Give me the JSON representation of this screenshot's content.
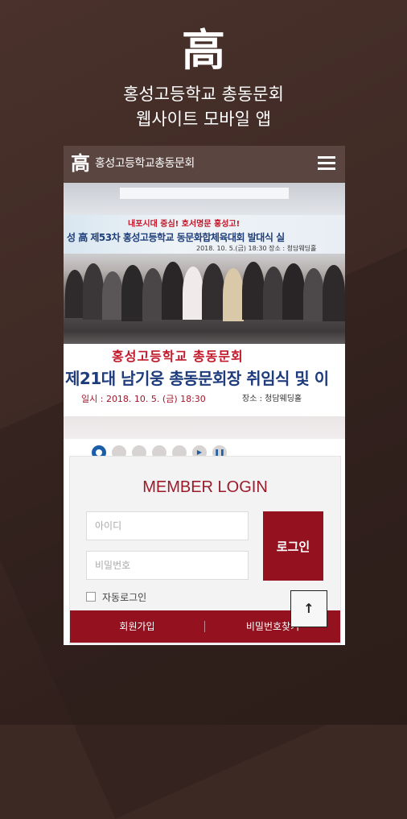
{
  "intro": {
    "logo_char": "高",
    "line1": "홍성고등학교 총동문회",
    "line2": "웹사이트 모바일 앱"
  },
  "app": {
    "logo_char": "高",
    "title": "홍성고등학교총동문회",
    "menu_icon": "hamburger-icon"
  },
  "slide": {
    "top_banner_slogan": "내포시대 중심! 호서명문 홍성고!",
    "top_banner_title": "성 高 제53차 홍성고등학교 동문화합체육대회 발대식 실",
    "top_banner_sub": "2018. 10. 5.(금) 18:30  장소 : 청담웨딩홀",
    "banner_line1": "홍성고등학교 총동문회",
    "banner_line2": "제21대 남기웅 총동문회장 취임식 및 이",
    "banner_date": "일시 : 2018. 10. 5. (금) 18:30",
    "banner_place": "장소 : 청담웨딩홀",
    "dots": 5,
    "active_dot": 0,
    "controls": [
      "play-icon",
      "pause-icon"
    ]
  },
  "login": {
    "title": "MEMBER LOGIN",
    "id_placeholder": "아이디",
    "pw_placeholder": "비밀번호",
    "button": "로그인",
    "auto_login": "자동로그인",
    "signup": "회원가입",
    "find_password": "비밀번호찾기",
    "top_button": "↑"
  },
  "colors": {
    "background": "#3d2924",
    "header": "#5b4540",
    "accent": "#94111f",
    "title": "#9c1b2b"
  }
}
